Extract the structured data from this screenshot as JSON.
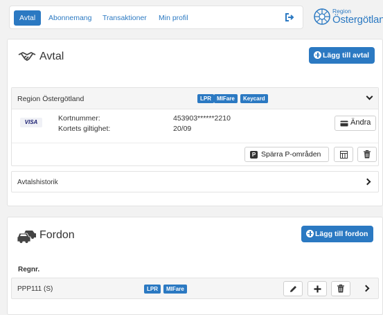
{
  "nav": {
    "tabs": [
      {
        "label": "Avtal",
        "active": true
      },
      {
        "label": "Abonnemang",
        "active": false
      },
      {
        "label": "Transaktioner",
        "active": false
      },
      {
        "label": "Min profil",
        "active": false
      }
    ],
    "logout_icon": "logout-icon"
  },
  "brand": {
    "line1": "Region",
    "line2": "Östergötland"
  },
  "avtal": {
    "title": "Avtal",
    "icon": "handshake-icon",
    "add_button": "Lägg till avtal",
    "contract": {
      "name": "Region Östergötland",
      "badges": [
        "LPR",
        "MIFare",
        "Keycard"
      ],
      "card_brand": "VISA",
      "card_number_label": "Kortnummer:",
      "card_number_value": "453903******2210",
      "card_validity_label": "Kortets giltighet:",
      "card_validity_value": "20/09",
      "edit_button": "Ändra",
      "block_button": "Spärra P-områden"
    },
    "history_label": "Avtalshistorik"
  },
  "fordon": {
    "title": "Fordon",
    "icon": "cars-icon",
    "add_button": "Lägg till fordon",
    "column_header": "Regnr.",
    "vehicles": [
      {
        "regnr": "PPP111 (S)",
        "badges": [
          "LPR",
          "MIFare"
        ]
      }
    ]
  },
  "colors": {
    "accent": "#2b79c2",
    "background": "#f2f2f2"
  }
}
